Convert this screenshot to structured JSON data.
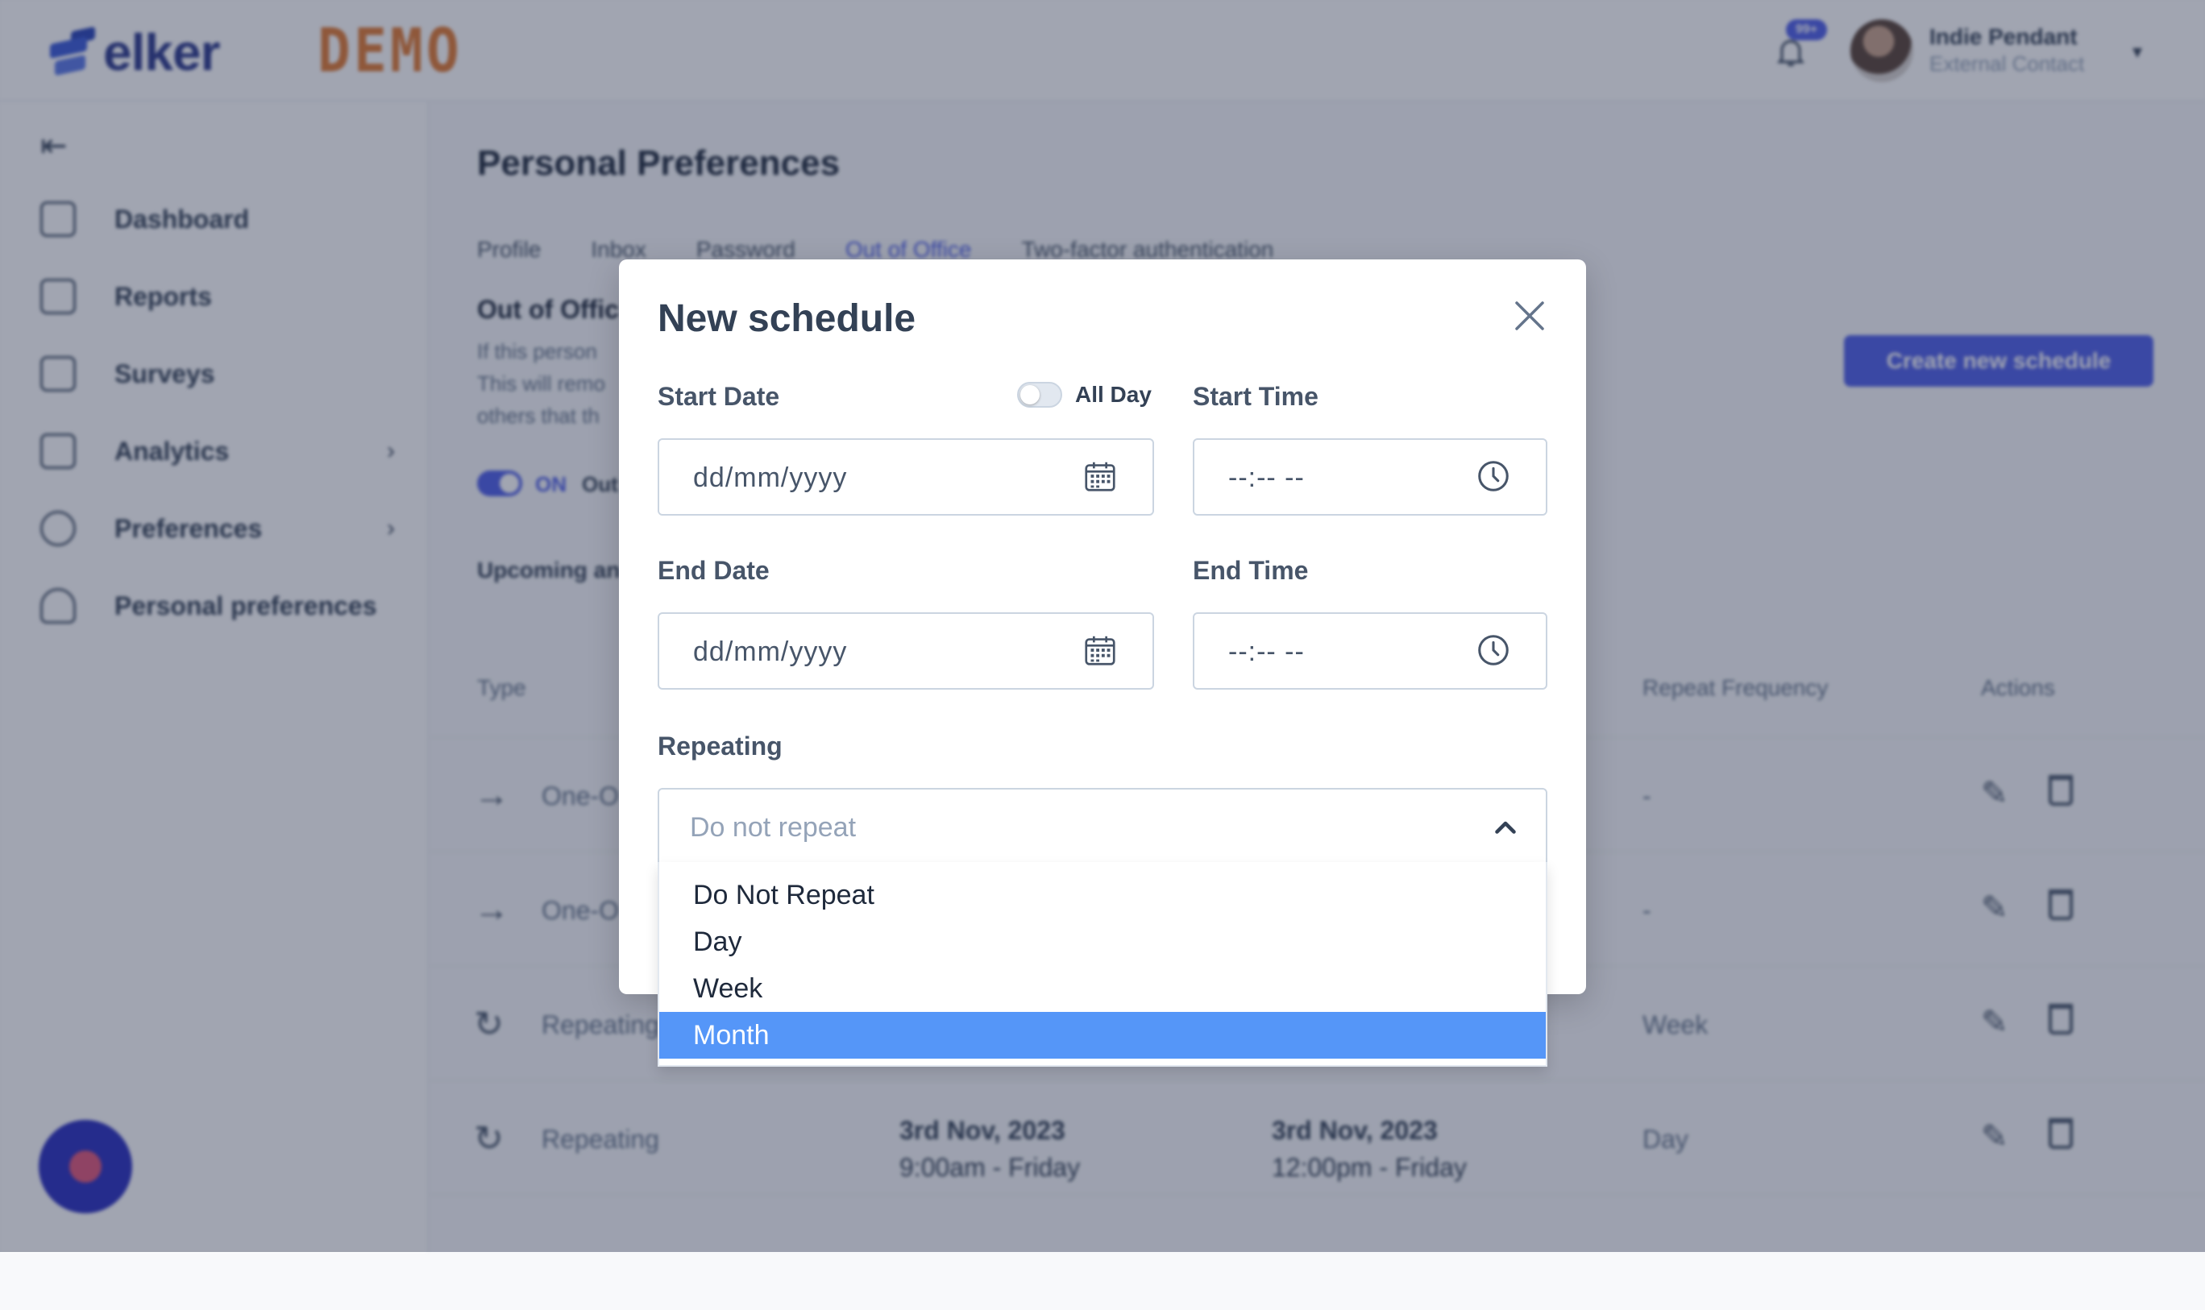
{
  "app": {
    "logo_text": "elker",
    "demo_label": "DEMO",
    "notification_badge": "99+",
    "user": {
      "name": "Indie Pendant",
      "role": "External Contact"
    }
  },
  "sidebar": {
    "items": [
      {
        "label": "Dashboard"
      },
      {
        "label": "Reports"
      },
      {
        "label": "Surveys"
      },
      {
        "label": "Analytics"
      },
      {
        "label": "Preferences"
      },
      {
        "label": "Personal preferences"
      }
    ]
  },
  "main": {
    "title": "Personal Preferences",
    "tabs": [
      {
        "label": "Profile"
      },
      {
        "label": "Inbox"
      },
      {
        "label": "Password"
      },
      {
        "label": "Out of Office"
      },
      {
        "label": "Two-factor authentication"
      }
    ],
    "section_title": "Out of Offic",
    "section_desc": [
      "If this person",
      "This will remo",
      "others that th"
    ],
    "create_button": "Create new schedule",
    "toggle_label": "ON",
    "toggle_text": "Out",
    "upcoming_label": "Upcoming an",
    "table": {
      "headers": {
        "type": "Type",
        "freq": "Repeat Frequency",
        "actions": "Actions"
      },
      "rows": [
        {
          "type": "One-O",
          "freq": "-",
          "start_date": "",
          "start_time": "",
          "end_date": "",
          "end_time": ""
        },
        {
          "type": "One-O",
          "freq": "-",
          "start_date": "",
          "start_time": "",
          "end_date": "",
          "end_time": ""
        },
        {
          "type": "Repeating",
          "freq": "Week",
          "start_date": "",
          "start_time": "",
          "end_date": "",
          "end_time": ""
        },
        {
          "type": "Repeating",
          "freq": "Day",
          "start_date": "3rd Nov, 2023",
          "start_time": "9:00am - Friday",
          "end_date": "3rd Nov, 2023",
          "end_time": "12:00pm - Friday"
        }
      ]
    }
  },
  "modal": {
    "title": "New schedule",
    "start_date_label": "Start Date",
    "all_day_label": "All Day",
    "start_time_label": "Start Time",
    "end_date_label": "End Date",
    "end_time_label": "End Time",
    "date_placeholder": "dd/mm/yyyy",
    "time_placeholder": "--:-- --",
    "repeating_label": "Repeating",
    "repeating_placeholder": "Do not repeat",
    "options": [
      "Do Not Repeat",
      "Day",
      "Week",
      "Month"
    ],
    "selected_option": "Month"
  },
  "colors": {
    "accent": "#4f5fe8",
    "selected": "#5596f8"
  }
}
